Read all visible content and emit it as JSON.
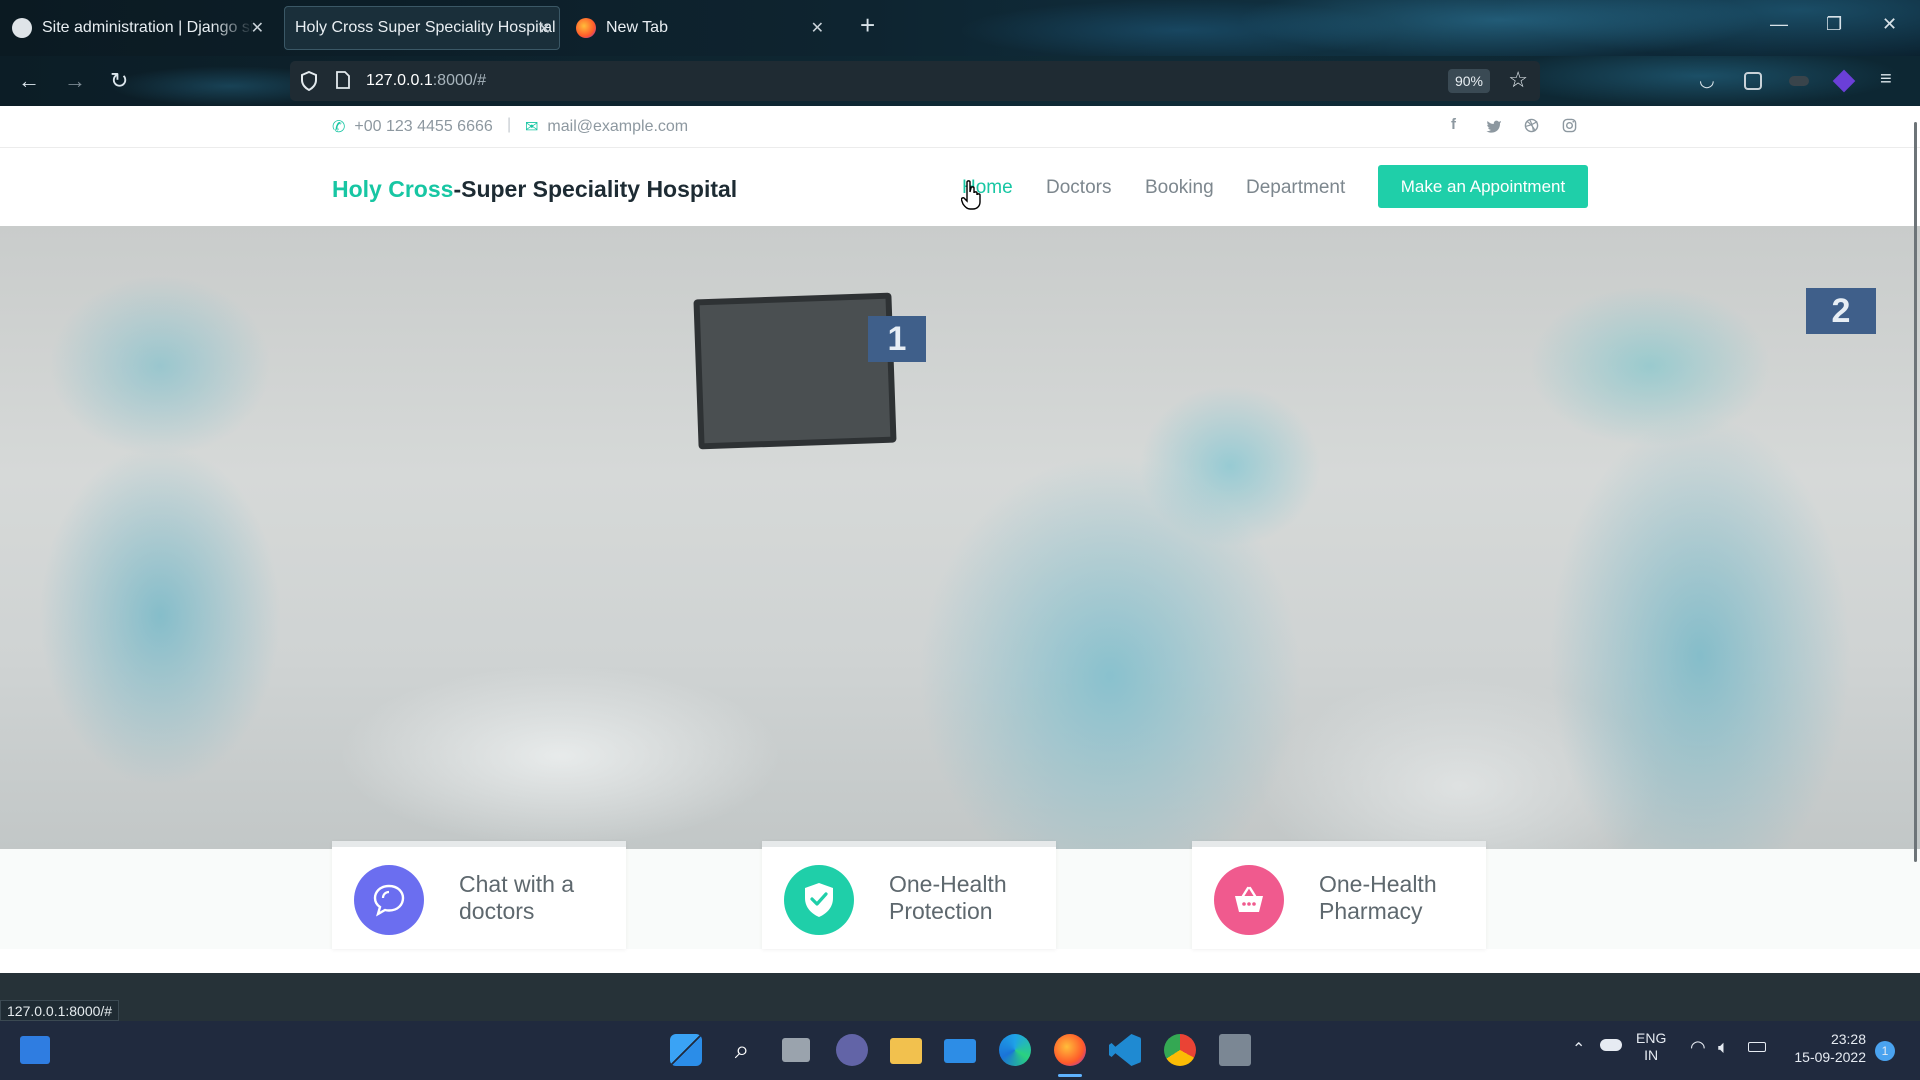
{
  "browser": {
    "tabs": [
      {
        "title": "Site administration | Django site admin",
        "active": false
      },
      {
        "title": "Holy Cross Super Speciality Hospital",
        "active": true
      },
      {
        "title": "New Tab",
        "active": false
      }
    ],
    "url_host": "127.0.0.1",
    "url_rest": ":8000/#",
    "zoom": "90%",
    "status_url": "127.0.0.1:8000/#"
  },
  "topbar": {
    "phone": "+00 123 4455 6666",
    "separator": "|",
    "email": "mail@example.com",
    "social": [
      "facebook-icon",
      "twitter-icon",
      "dribbble-icon",
      "instagram-icon"
    ]
  },
  "header": {
    "brand_accent": "Holy Cross",
    "brand_rest": "-Super Speciality Hospital",
    "menu": [
      "Home",
      "Doctors",
      "Booking",
      "Department"
    ],
    "active_menu": "Home",
    "cta": "Make an Appointment"
  },
  "hero": {
    "bed_numbers": [
      "1",
      "2"
    ]
  },
  "features": [
    {
      "label": "Chat with a doctors",
      "icon": "chat-icon",
      "color": "#6b6ef0"
    },
    {
      "label": "One-Health Protection",
      "icon": "shield-check-icon",
      "color": "#1fcfa9"
    },
    {
      "label": "One-Health Pharmacy",
      "icon": "basket-icon",
      "color": "#f05a8e"
    }
  ],
  "taskbar": {
    "language": "ENG",
    "region": "IN",
    "time": "23:28",
    "date": "15-09-2022",
    "notification_count": "1"
  },
  "colors": {
    "accent": "#17c6a3",
    "cta": "#1fcfa9",
    "dark_band": "#263238"
  }
}
